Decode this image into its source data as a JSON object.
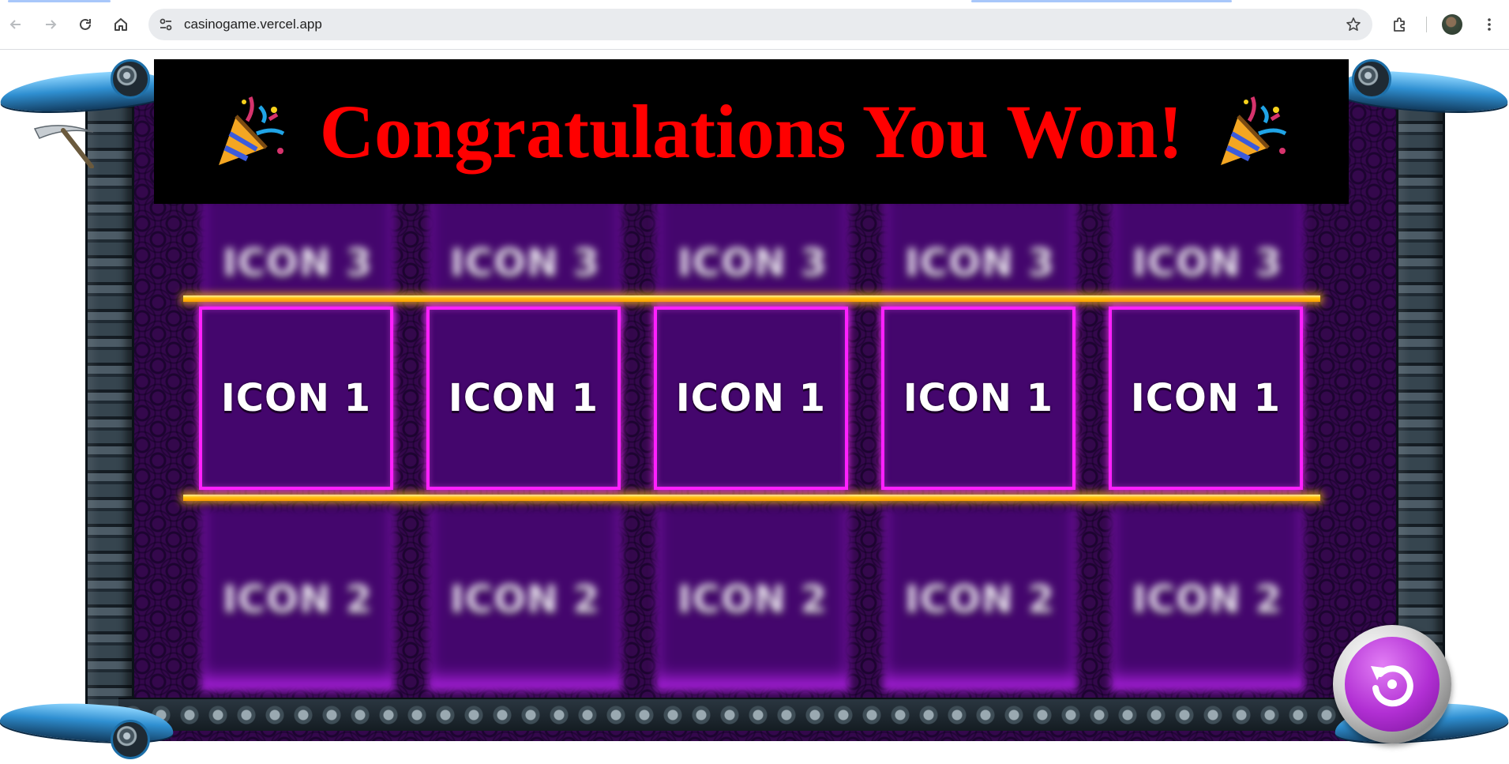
{
  "browser": {
    "url": "casinogame.vercel.app",
    "back_icon": "arrow-left-icon",
    "forward_icon": "arrow-right-icon",
    "reload_icon": "reload-icon",
    "home_icon": "home-icon",
    "site_info_icon": "tune-icon",
    "bookmark_icon": "star-icon",
    "extensions_icon": "puzzle-icon",
    "menu_icon": "kebab-menu-icon"
  },
  "game": {
    "banner": {
      "title": "Congratulations You Won!",
      "left_icon": "party-popper-icon",
      "right_icon": "party-popper-icon",
      "title_color": "#ff0000"
    },
    "reels": {
      "top_row": [
        "ICON 3",
        "ICON 3",
        "ICON 3",
        "ICON 3",
        "ICON 3"
      ],
      "middle_row": [
        "ICON 1",
        "ICON 1",
        "ICON 1",
        "ICON 1",
        "ICON 1"
      ],
      "bottom_row": [
        "ICON 2",
        "ICON 2",
        "ICON 2",
        "ICON 2",
        "ICON 2"
      ],
      "winning_row": "middle_row"
    },
    "spin_button_icon": "replay-icon",
    "colors": {
      "cell": "#44066d",
      "win_border": "#ff20ff",
      "payline": "#ffc20c",
      "board": "#34084c"
    }
  }
}
